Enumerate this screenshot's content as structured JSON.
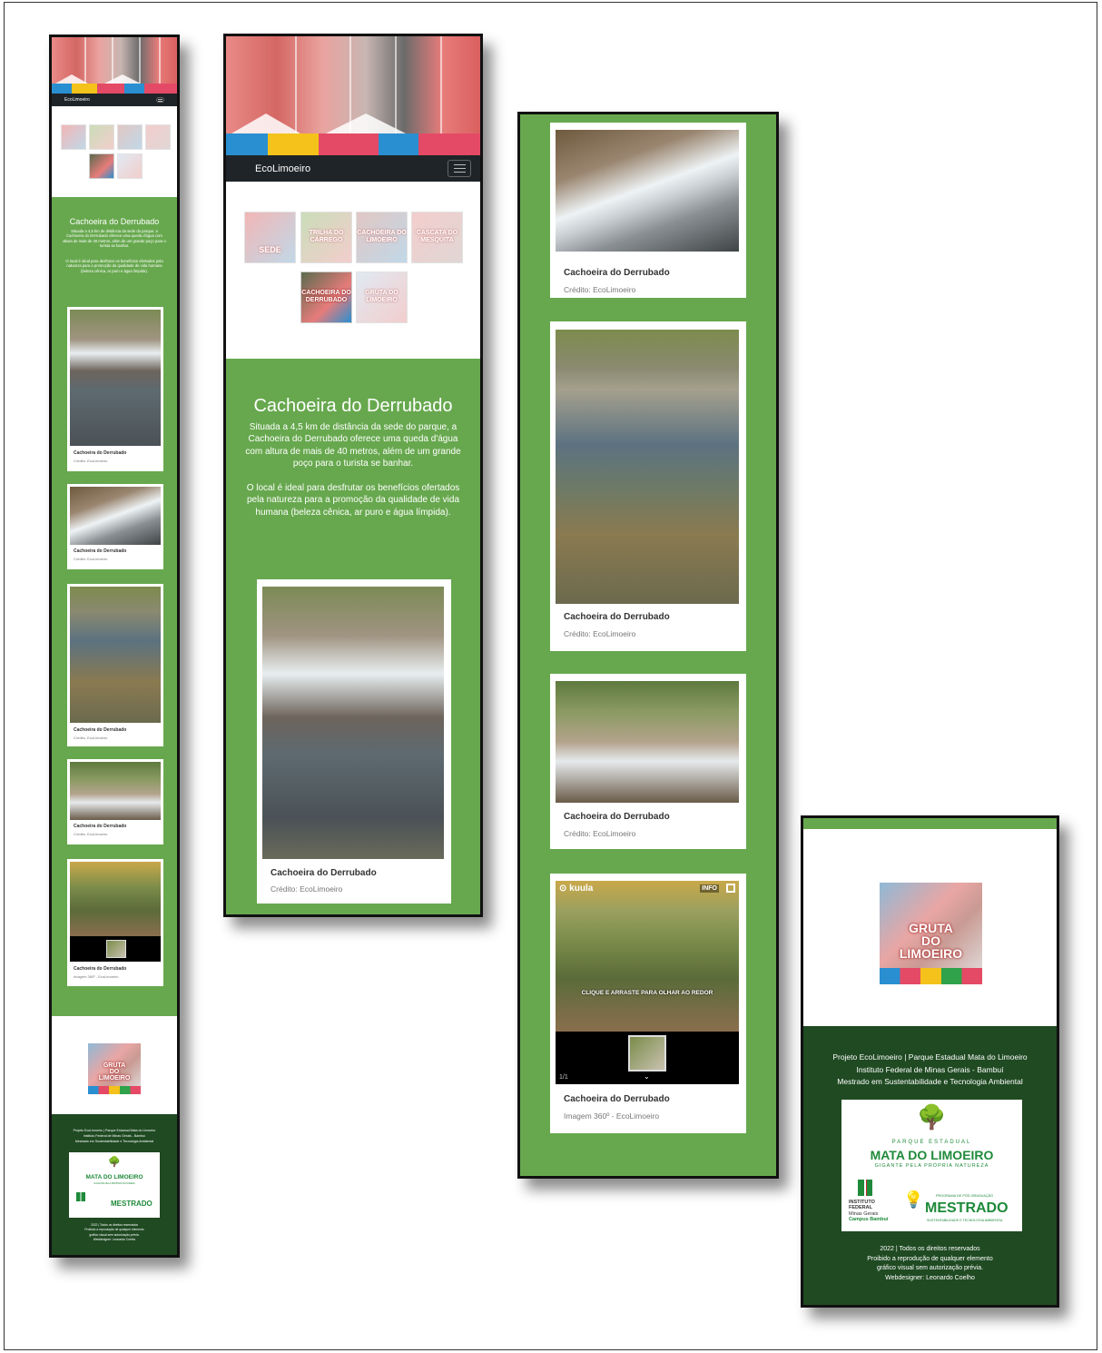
{
  "colors": {
    "green": "#67a84e",
    "dark_green": "#1f4a22",
    "navbar": "#1f2428",
    "logo_green": "#1e8a3a"
  },
  "site": {
    "brand": "EcoLimoeiro",
    "menu_icon": "hamburger-icon"
  },
  "thumbnails": [
    "SEDE",
    "TRILHA DO CÁRREGO",
    "CACHOEIRA DO LIMOEIRO",
    "CASCATA DO MESQUITA",
    "CACHOEIRA DO DERRUBADO",
    "GRUTA DO LIMOEIRO"
  ],
  "section": {
    "title": "Cachoeira do Derrubado",
    "paragraph1": "Situada a 4,5 km de distância da sede do parque, a Cachoeira do Derrubado oferece uma queda d'água com altura de mais de 40 metros, além de um grande poço para o turista se banhar.",
    "paragraph2": "O local é ideal para desfrutar os benefícios ofertados pela natureza para a promoção da qualidade de vida humana (beleza cênica, ar puro e água límpida)."
  },
  "cards": [
    {
      "title": "Cachoeira do Derrubado",
      "subtitle": "Crédito: EcoLimoeiro"
    },
    {
      "title": "Cachoeira do Derrubado",
      "subtitle": "Crédito: EcoLimoeiro"
    },
    {
      "title": "Cachoeira do Derrubado",
      "subtitle": "Crédito: EcoLimoeiro"
    },
    {
      "title": "Cachoeira do Derrubado",
      "subtitle": "Crédito: EcoLimoeiro"
    },
    {
      "title": "Cachoeira do Derrubado",
      "subtitle": "Imagem 360º - EcoLimoeiro"
    }
  ],
  "viewer": {
    "brand": "kuula",
    "info": "INFO",
    "instruction": "CLIQUE E ARRASTE PARA OLHAR AO REDOR",
    "counter": "1/1"
  },
  "gruta_logo": {
    "line1": "GRUTA",
    "line2": "DO",
    "line3": "LIMOEIRO"
  },
  "footer": {
    "line1": "Projeto EcoLimoeiro | Parque Estadual Mata do Limoeiro",
    "line2": "Instituto Federal de Minas Gerais - Bambuí",
    "line3": "Mestrado em Sustentabilidade e Tecnologia Ambiental",
    "copy1": "2022 | Todos os direitos reservados",
    "copy2": "Proibido a reprodução de qualquer elemento",
    "copy3": "gráfico visual sem autorização prévia.",
    "copy4": "Webdesigner: Leonardo Coelho"
  },
  "partners": {
    "park_top": "PARQUE ESTADUAL",
    "park_name": "MATA DO LIMOEIRO",
    "park_tag": "GIGANTE PELA PRÓPRIA NATUREZA",
    "if_line1": "INSTITUTO",
    "if_line2": "FEDERAL",
    "if_line3": "Minas Gerais",
    "if_line4": "Campus Bambuí",
    "mestrado_top": "PROGRAMA DE PÓS-GRADUAÇÃO",
    "mestrado": "MESTRADO",
    "mestrado_sub": "SUSTENTABILIDADE E TECNOLOGIA AMBIENTAL"
  }
}
